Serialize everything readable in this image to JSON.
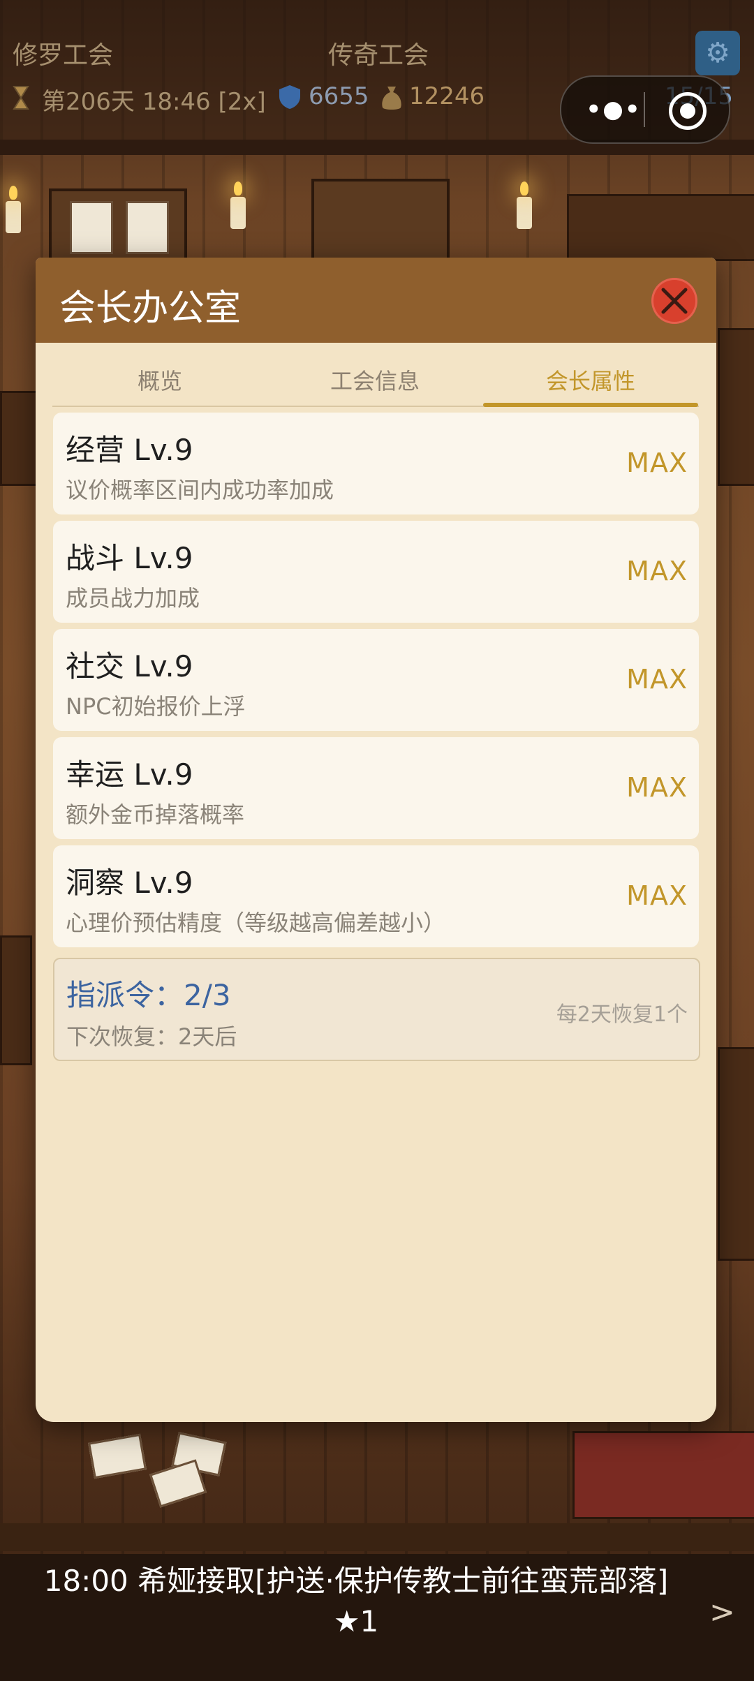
{
  "hud": {
    "guild_left": "修罗工会",
    "guild_center": "传奇工会",
    "day_time": "第206天 18:46 [2x]",
    "shield_value": "6655",
    "gold_value": "12246",
    "members_value": "15/15"
  },
  "dialog": {
    "title": "会长办公室",
    "tabs": [
      {
        "label": "概览",
        "active": false
      },
      {
        "label": "工会信息",
        "active": false
      },
      {
        "label": "会长属性",
        "active": true
      }
    ],
    "attributes": [
      {
        "name": "经营 Lv.9",
        "desc": "议价概率区间内成功率加成",
        "status": "MAX"
      },
      {
        "name": "战斗 Lv.9",
        "desc": "成员战力加成",
        "status": "MAX"
      },
      {
        "name": "社交 Lv.9",
        "desc": "NPC初始报价上浮",
        "status": "MAX"
      },
      {
        "name": "幸运 Lv.9",
        "desc": "额外金币掉落概率",
        "status": "MAX"
      },
      {
        "name": "洞察 Lv.9",
        "desc": "心理价预估精度（等级越高偏差越小）",
        "status": "MAX"
      }
    ],
    "dispatch": {
      "title": "指派令：2/3",
      "next": "下次恢复：2天后",
      "rule": "每2天恢复1个"
    }
  },
  "ticker": {
    "line1": "18:00 希娅接取[护送·保护传教士前往蛮荒部落]",
    "line2": "★1",
    "arrow": ">"
  },
  "icons": [
    "hourglass-icon",
    "shield-icon",
    "money-bag-icon",
    "settings-icon",
    "more-icon",
    "target-icon",
    "close-icon"
  ],
  "colors": {
    "accent": "#c2962a",
    "header": "#8f5f2d",
    "close": "#d8402d",
    "link_blue": "#3c64a0"
  }
}
